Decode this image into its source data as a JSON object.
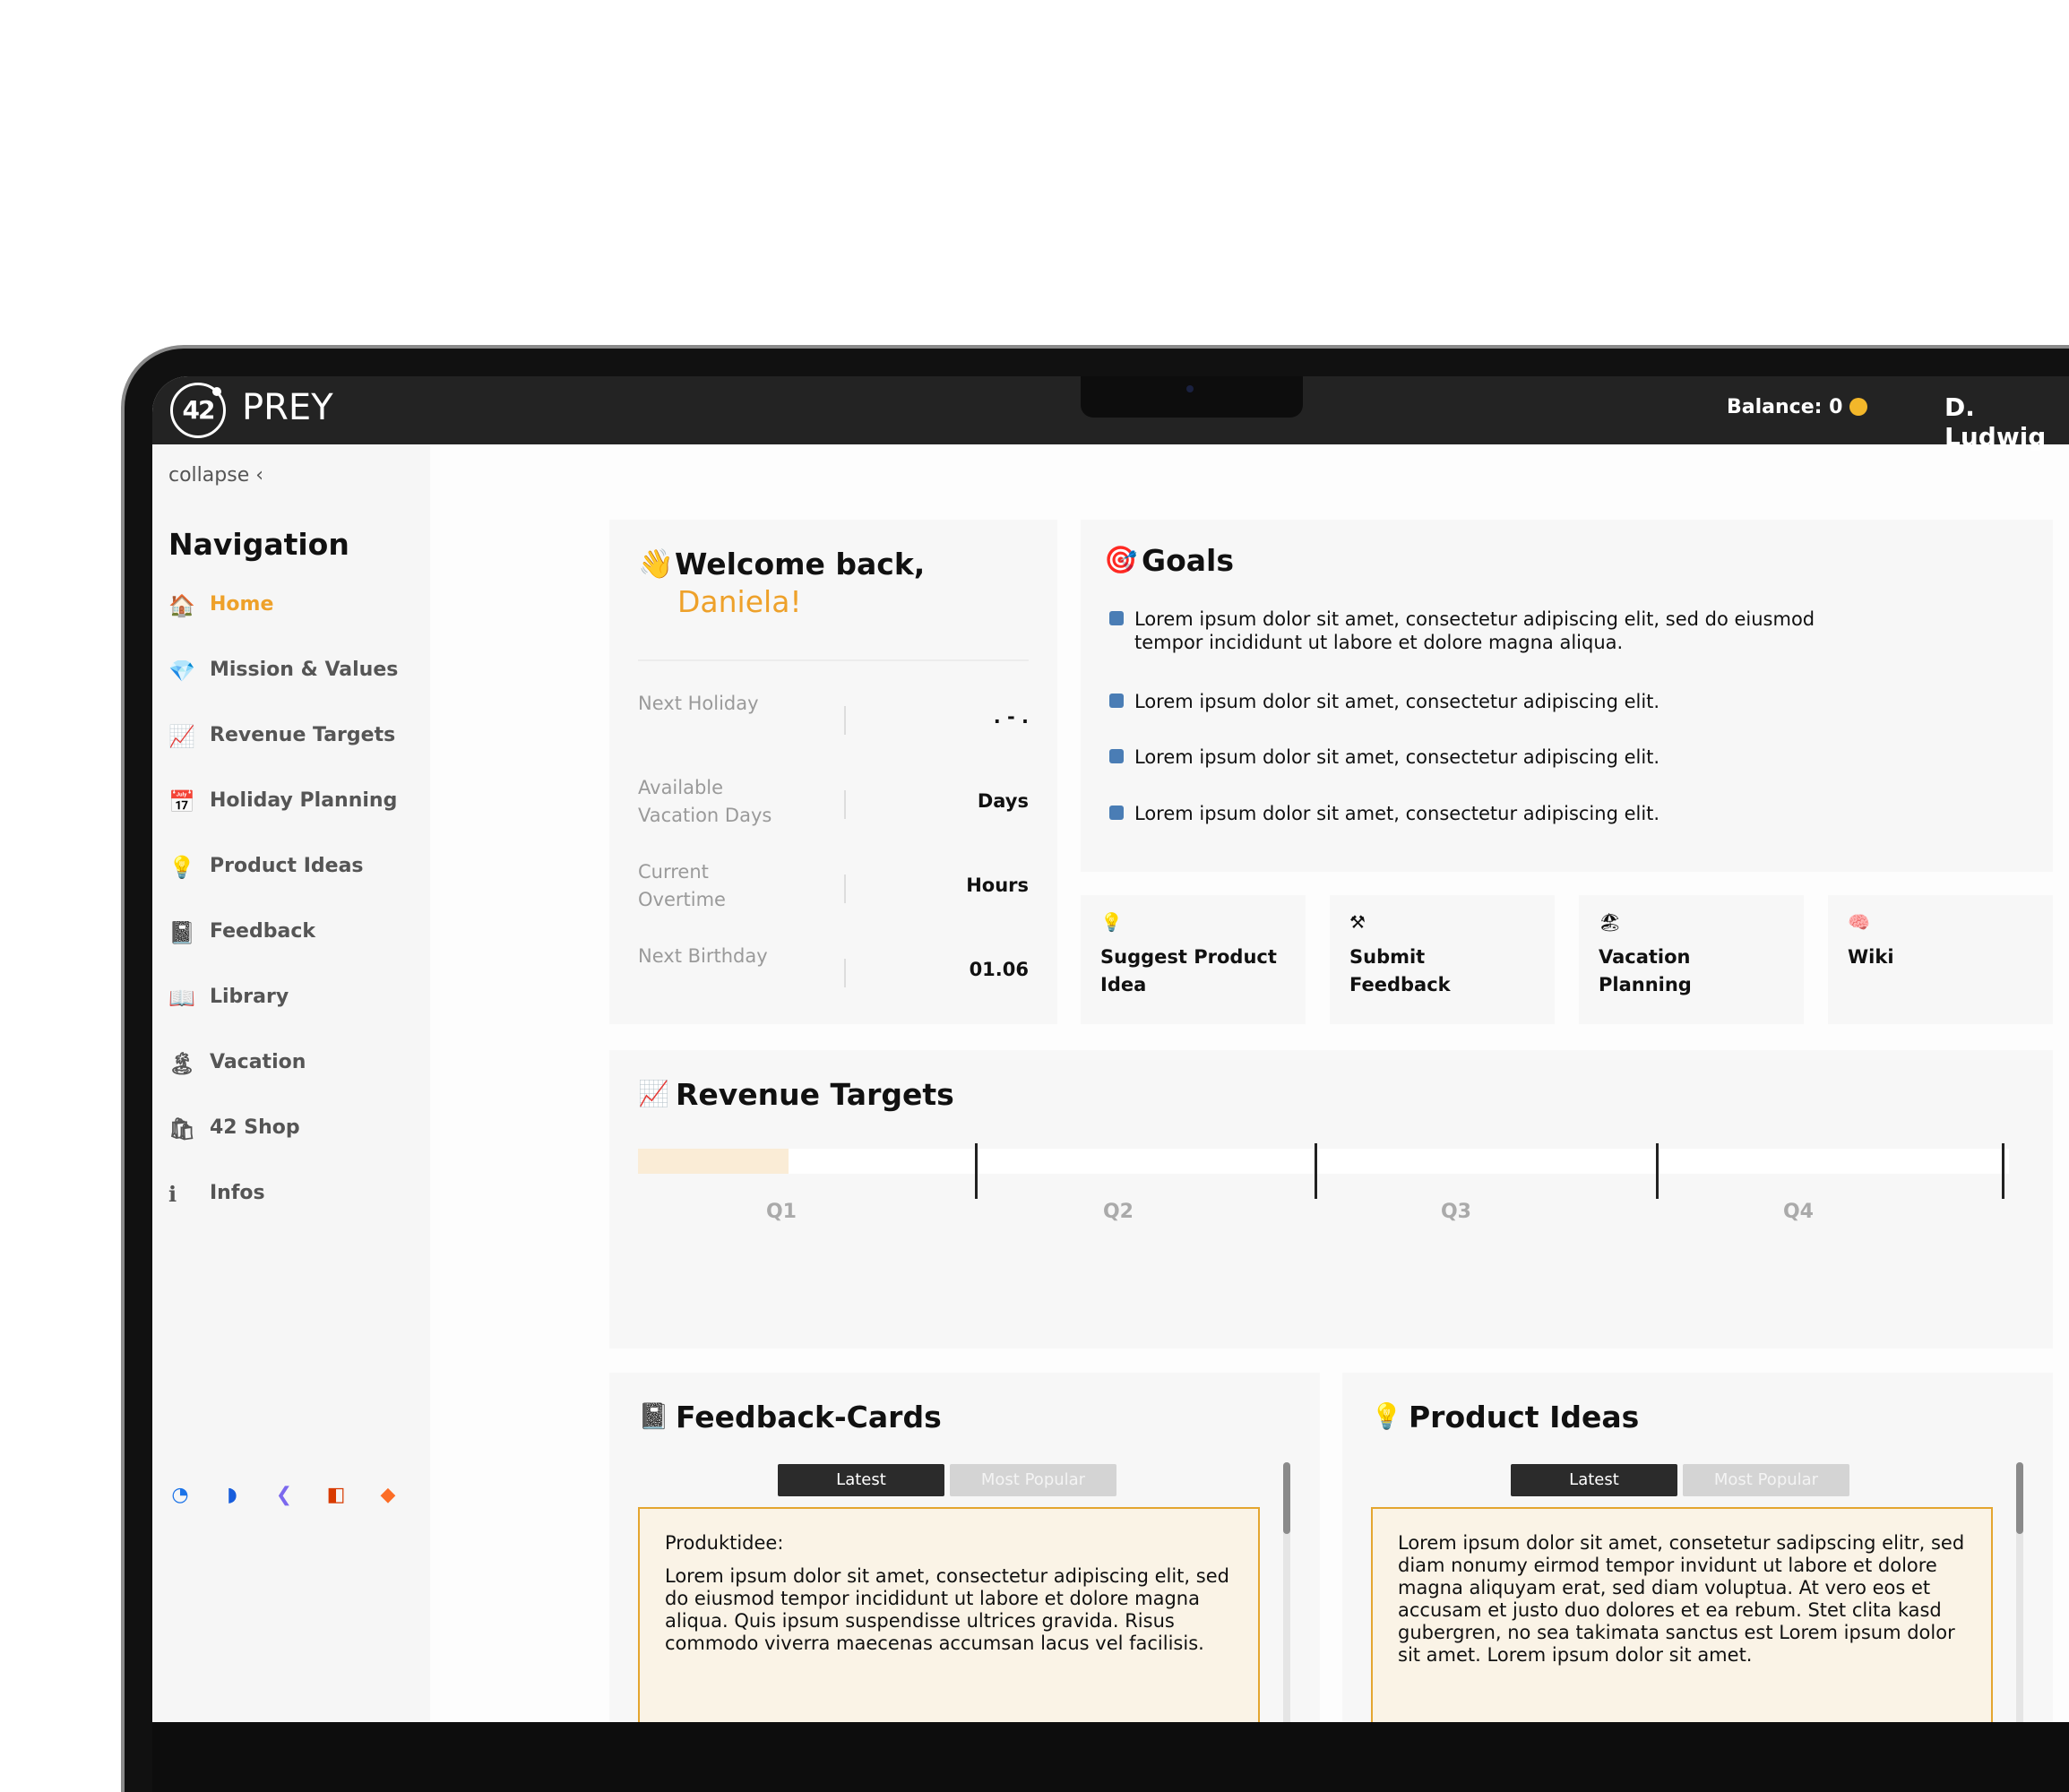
{
  "topbar": {
    "logo_text": "42",
    "brand": "PREY",
    "balance": "Balance: 0",
    "user": "D. Ludwig"
  },
  "sidebar": {
    "collapse": "collapse ‹",
    "title": "Navigation",
    "items": [
      {
        "icon": "🏠",
        "label": "Home"
      },
      {
        "icon": "💎",
        "label": "Mission & Values"
      },
      {
        "icon": "📈",
        "label": "Revenue Targets"
      },
      {
        "icon": "📅",
        "label": "Holiday Planning"
      },
      {
        "icon": "💡",
        "label": "Product Ideas"
      },
      {
        "icon": "📓",
        "label": "Feedback"
      },
      {
        "icon": "📖",
        "label": "Library"
      },
      {
        "icon": "🏝",
        "label": "Vacation"
      },
      {
        "icon": "🛍",
        "label": "42 Shop"
      },
      {
        "icon": "ℹ",
        "label": "Infos"
      }
    ],
    "tools": [
      {
        "icon": "◔",
        "color": "#1b73e8"
      },
      {
        "icon": "◗",
        "color": "#175ddc"
      },
      {
        "icon": "❮",
        "color": "#7b68ee"
      },
      {
        "icon": "◧",
        "color": "#d83b01"
      },
      {
        "icon": "◆",
        "color": "#fc6d26"
      }
    ]
  },
  "welcome": {
    "icon": "👋",
    "title": "Welcome back,",
    "name": "Daniela!",
    "stats": [
      {
        "label": "Next Holiday",
        "value": ". - ."
      },
      {
        "label": "Available Vacation Days",
        "value": "Days"
      },
      {
        "label": "Current Overtime",
        "value": "Hours"
      },
      {
        "label": "Next Birthday",
        "value": "01.06"
      }
    ]
  },
  "goals": {
    "icon": "🎯",
    "title": "Goals",
    "items": [
      "Lorem ipsum dolor sit amet, consectetur adipiscing elit, sed do eiusmod tempor incididunt ut labore et dolore magna aliqua.",
      "Lorem ipsum dolor sit amet, consectetur adipiscing elit.",
      "Lorem ipsum dolor sit amet, consectetur adipiscing elit.",
      "Lorem ipsum dolor sit amet, consectetur adipiscing elit."
    ]
  },
  "quick_links": [
    {
      "icon": "💡",
      "label": "Suggest Product Idea"
    },
    {
      "icon": "⚒",
      "label": "Submit Feedback"
    },
    {
      "icon": "🏖",
      "label": "Vacation Planning"
    },
    {
      "icon": "🧠",
      "label": "Wiki"
    }
  ],
  "revenue": {
    "icon": "📈",
    "title": "Revenue Targets",
    "progress": 0.11,
    "quarters": [
      "Q1",
      "Q2",
      "Q3",
      "Q4"
    ],
    "fill_color": "#faecd6"
  },
  "feedback": {
    "icon": "📓",
    "title": "Feedback-Cards",
    "tabs": [
      "Latest",
      "Most Popular"
    ],
    "entry_head": "Produktidee:",
    "entry_text": "Lorem ipsum dolor sit amet, consectetur adipiscing elit, sed do eiusmod tempor incididunt ut labore et dolore magna aliqua. Quis ipsum suspendisse ultrices gravida. Risus commodo viverra maecenas accumsan lacus vel facilisis."
  },
  "ideas": {
    "icon": "💡",
    "title": "Product Ideas",
    "tabs": [
      "Latest",
      "Most Popular"
    ],
    "entry_text": "Lorem ipsum dolor sit amet, consetetur sadipscing elitr, sed diam nonumy eirmod tempor invidunt ut labore et dolore magna aliquyam erat, sed diam voluptua. At vero eos et accusam et justo duo dolores et ea rebum. Stet clita kasd gubergren, no sea takimata sanctus est Lorem ipsum dolor sit amet. Lorem ipsum dolor sit amet."
  },
  "colors": {
    "accent": "#eea12a",
    "topbar": "#232323",
    "card": "#f7f7f7"
  }
}
